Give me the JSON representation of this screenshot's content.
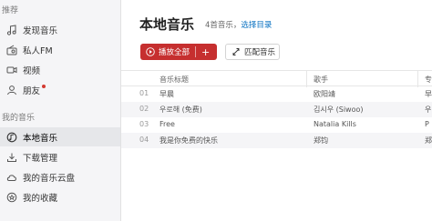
{
  "sidebar": {
    "section1": "推荐",
    "items1": [
      {
        "label": "发现音乐",
        "icon": "music-note-icon"
      },
      {
        "label": "私人FM",
        "icon": "radio-icon"
      },
      {
        "label": "视频",
        "icon": "video-icon"
      },
      {
        "label": "朋友",
        "icon": "friends-icon",
        "badge": true
      }
    ],
    "section2": "我的音乐",
    "items2": [
      {
        "label": "本地音乐",
        "icon": "local-music-icon",
        "active": true
      },
      {
        "label": "下载管理",
        "icon": "download-icon"
      },
      {
        "label": "我的音乐云盘",
        "icon": "cloud-icon"
      },
      {
        "label": "我的收藏",
        "icon": "favorites-icon"
      }
    ]
  },
  "main": {
    "title": "本地音乐",
    "count": "4首音乐，",
    "choose_dir": "选择目录",
    "play_all": "播放全部",
    "add": "+",
    "match": "匹配音乐"
  },
  "table": {
    "headers": {
      "title": "音乐标题",
      "artist": "歌手",
      "album": "专"
    },
    "rows": [
      {
        "num": "01",
        "title": "早晨",
        "artist": "欧阳靖",
        "album": "早"
      },
      {
        "num": "02",
        "title": "우로해 (免费)",
        "artist": "김시우 (Siwoo)",
        "album": "우"
      },
      {
        "num": "03",
        "title": "Free",
        "artist": "Natalia Kills",
        "album": "P"
      },
      {
        "num": "04",
        "title": "我是你免费的快乐",
        "artist": "郑钧",
        "album": "郑"
      }
    ]
  },
  "colors": {
    "accent": "#c62f2f",
    "link": "#0c73c2",
    "sidebar_bg": "#f5f5f7"
  }
}
